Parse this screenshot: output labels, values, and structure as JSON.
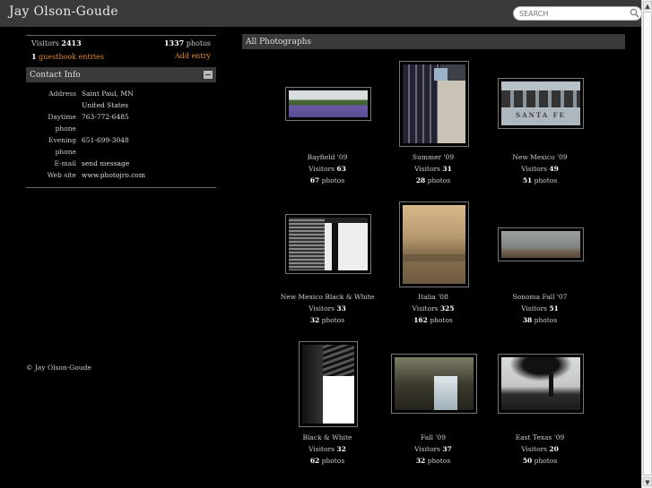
{
  "site": {
    "title": "Jay Olson-Goude"
  },
  "search": {
    "placeholder": "SEARCH"
  },
  "stats": {
    "visitors_label": "Visitors",
    "visitors": "2413",
    "photos_count": "1337",
    "photos_label": "photos",
    "guestbook_count": "1",
    "guestbook_label": "guestbook entries",
    "add_entry": "Add entry"
  },
  "contact": {
    "heading": "Contact Info",
    "rows": [
      {
        "key": "Address",
        "value": "Saint Paul, MN"
      },
      {
        "key": "",
        "value": "United States"
      },
      {
        "key": "Daytime phone",
        "value": "763-772-6485"
      },
      {
        "key": "Evening phone",
        "value": "651-699-3048"
      },
      {
        "key": "E-mail",
        "value": "send message"
      },
      {
        "key": "Web site",
        "value": "www.photojro.com"
      }
    ]
  },
  "copyright": "© Jay Olson-Goude",
  "gallery": {
    "heading": "All Photographs",
    "visitors_label": "Visitors",
    "photos_label": "photos",
    "albums": [
      {
        "name": "Bayfield '09",
        "visitors": "63",
        "photos": "67"
      },
      {
        "name": "Summer '09",
        "visitors": "31",
        "photos": "28"
      },
      {
        "name": "New Mexico '09",
        "visitors": "49",
        "photos": "51"
      },
      {
        "name": "New Mexico Black & White",
        "visitors": "33",
        "photos": "32"
      },
      {
        "name": "Italia '08",
        "visitors": "325",
        "photos": "162"
      },
      {
        "name": "Sonoma Fall '07",
        "visitors": "51",
        "photos": "38"
      },
      {
        "name": "Black & White",
        "visitors": "32",
        "photos": "62"
      },
      {
        "name": "Fall '09",
        "visitors": "37",
        "photos": "32"
      },
      {
        "name": "East Texas '09",
        "visitors": "20",
        "photos": "50"
      }
    ]
  },
  "thumb_sign_text": "SANTA FE"
}
